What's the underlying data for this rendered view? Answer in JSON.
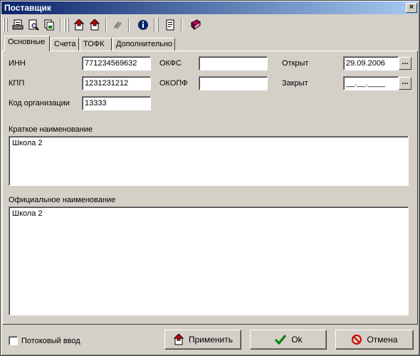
{
  "window": {
    "title": "Поставщик"
  },
  "tabs": [
    {
      "label": "Основные"
    },
    {
      "label": "Счета"
    },
    {
      "label": "ТОФК"
    },
    {
      "label": "Дополнительно"
    }
  ],
  "fields": {
    "inn": {
      "label": "ИНН",
      "value": "771234569632"
    },
    "kpp": {
      "label": "КПП",
      "value": "1231231212"
    },
    "org_code": {
      "label": "Код организации",
      "value": "13333"
    },
    "okfs": {
      "label": "ОКФС",
      "value": ""
    },
    "okopf": {
      "label": "ОКОПФ",
      "value": ""
    },
    "opened": {
      "label": "Открыт",
      "value": "29.09.2006"
    },
    "closed": {
      "label": "Закрыт",
      "value": "__.__.____"
    },
    "short_name": {
      "label": "Краткое наименование",
      "value": "Школа 2"
    },
    "official_name": {
      "label": "Официальное наименование",
      "value": "Школа 2"
    }
  },
  "ellipsis": "...",
  "footer": {
    "stream_input": "Потоковый ввод",
    "apply": "Применить",
    "ok": "Ok",
    "cancel": "Отмена"
  },
  "close_glyph": "×"
}
